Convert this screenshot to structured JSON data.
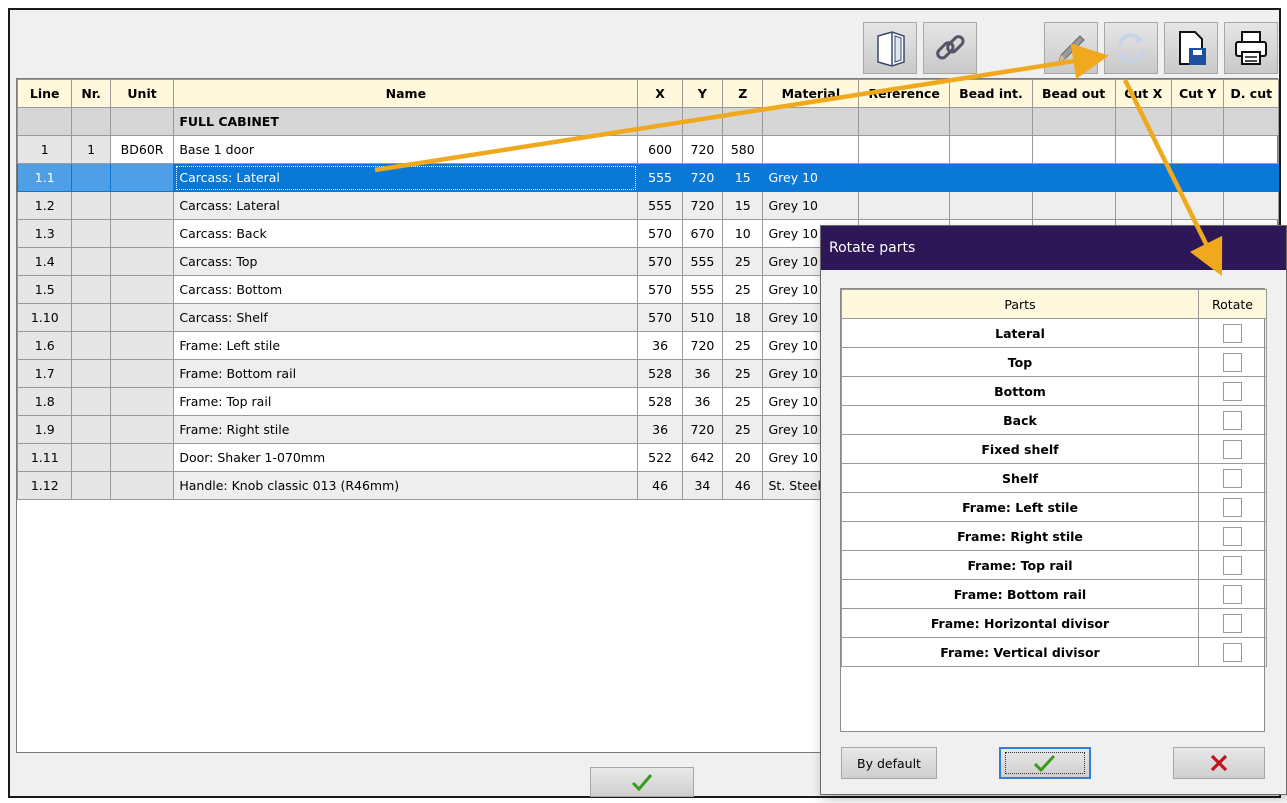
{
  "toolbar": {
    "icons": [
      "cabinet-icon",
      "link-icon",
      "pencil-icon",
      "rotate-icon",
      "save-icon",
      "print-icon"
    ]
  },
  "grid": {
    "headers": {
      "line": "Line",
      "nr": "Nr.",
      "unit": "Unit",
      "name": "Name",
      "x": "X",
      "y": "Y",
      "z": "Z",
      "material": "Material",
      "reference": "Reference",
      "bead_int": "Bead int.",
      "bead_out": "Bead out",
      "cut_x": "Cut X",
      "cut_y": "Cut Y",
      "d_cut": "D. cut"
    },
    "group_label": "FULL CABINET",
    "unit_row": {
      "line": "1",
      "nr": "1",
      "unit": "BD60R",
      "name": "Base 1 door",
      "x": "600",
      "y": "720",
      "z": "580"
    },
    "rows": [
      {
        "line": "1.1",
        "name": "Carcass: Lateral",
        "x": "555",
        "y": "720",
        "z": "15",
        "material": "Grey 10"
      },
      {
        "line": "1.2",
        "name": "Carcass: Lateral",
        "x": "555",
        "y": "720",
        "z": "15",
        "material": "Grey 10"
      },
      {
        "line": "1.3",
        "name": "Carcass: Back",
        "x": "570",
        "y": "670",
        "z": "10",
        "material": "Grey 10"
      },
      {
        "line": "1.4",
        "name": "Carcass: Top",
        "x": "570",
        "y": "555",
        "z": "25",
        "material": "Grey 10"
      },
      {
        "line": "1.5",
        "name": "Carcass: Bottom",
        "x": "570",
        "y": "555",
        "z": "25",
        "material": "Grey 10"
      },
      {
        "line": "1.10",
        "name": "Carcass: Shelf",
        "x": "570",
        "y": "510",
        "z": "18",
        "material": "Grey 10"
      },
      {
        "line": "1.6",
        "name": "Frame: Left stile",
        "x": "36",
        "y": "720",
        "z": "25",
        "material": "Grey 10"
      },
      {
        "line": "1.7",
        "name": "Frame: Bottom rail",
        "x": "528",
        "y": "36",
        "z": "25",
        "material": "Grey 10"
      },
      {
        "line": "1.8",
        "name": "Frame: Top rail",
        "x": "528",
        "y": "36",
        "z": "25",
        "material": "Grey 10"
      },
      {
        "line": "1.9",
        "name": "Frame: Right stile",
        "x": "36",
        "y": "720",
        "z": "25",
        "material": "Grey 10"
      },
      {
        "line": "1.11",
        "name": "Door: Shaker 1-070mm",
        "x": "522",
        "y": "642",
        "z": "20",
        "material": "Grey 10"
      },
      {
        "line": "1.12",
        "name": "Handle: Knob classic 013 (R46mm)",
        "x": "46",
        "y": "34",
        "z": "46",
        "material": "St. Steel"
      }
    ]
  },
  "dialog": {
    "title": "Rotate parts",
    "header_parts": "Parts",
    "header_rotate": "Rotate",
    "parts": [
      "Lateral",
      "Top",
      "Bottom",
      "Back",
      "Fixed shelf",
      "Shelf",
      "Frame: Left stile",
      "Frame: Right stile",
      "Frame: Top rail",
      "Frame: Bottom rail",
      "Frame: Horizontal divisor",
      "Frame: Vertical divisor"
    ],
    "by_default_label": "By default"
  },
  "colors": {
    "selection": "#0a78d7",
    "header_bg": "#fff8dc",
    "dialog_title_bg": "#2e1757",
    "arrow": "#f0a81c",
    "ok_check": "#3a9a1a",
    "cancel_x": "#c0141c"
  }
}
